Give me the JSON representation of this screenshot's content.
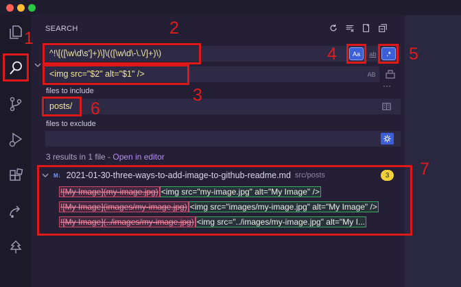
{
  "window": {
    "controls": [
      {
        "name": "close",
        "color": "#fe5f57"
      },
      {
        "name": "minimize",
        "color": "#febc2e"
      },
      {
        "name": "maximize",
        "color": "#28c840"
      }
    ]
  },
  "activity_bar": {
    "items": [
      {
        "id": "explorer",
        "icon": "files-icon"
      },
      {
        "id": "search",
        "icon": "search-icon",
        "active": true
      },
      {
        "id": "source-control",
        "icon": "source-control-icon"
      },
      {
        "id": "run-debug",
        "icon": "run-debug-icon"
      },
      {
        "id": "extensions",
        "icon": "extensions-icon"
      },
      {
        "id": "remote",
        "icon": "remote-icon"
      },
      {
        "id": "tree",
        "icon": "tree-icon"
      }
    ]
  },
  "search": {
    "title": "SEARCH",
    "actions": [
      "refresh-icon",
      "clear-results-icon",
      "new-search-editor-icon",
      "collapse-all-icon"
    ],
    "query": "^!\\[([\\w\\d\\s']+)\\]\\(([\\w\\d\\-\\.\\/]+)\\)",
    "replace": "<img src=\"$2\" alt=\"$1\" />",
    "match_case_label": "Aa",
    "whole_word_label": "ab",
    "regex_label": ".*",
    "preserve_case_label": "AB",
    "files_to_include_label": "files to include",
    "files_to_include": "posts/",
    "files_to_exclude_label": "files to exclude",
    "files_to_exclude": "",
    "more_options": "···"
  },
  "results": {
    "summary": "3 results in 1 file - ",
    "open_in_editor": "Open in editor",
    "file": {
      "badge": "M↓",
      "name": "2021-01-30-three-ways-to-add-image-to-github-readme.md",
      "path": "src/posts",
      "count": "3"
    },
    "matches": [
      {
        "old": "![My Image](my-image.jpg)",
        "new": "<img src=\"my-image.jpg\" alt=\"My Image\" />"
      },
      {
        "old": "![My Image](images/my-image.jpg)",
        "new": "<img src=\"images/my-image.jpg\" alt=\"My Image\" />"
      },
      {
        "old": "![My Image](../images/my-image.jpg)",
        "new": "<img src=\"../images/my-image.jpg\" alt=\"My I..."
      }
    ]
  },
  "annotations": {
    "labels": [
      "1",
      "2",
      "3",
      "4",
      "5",
      "6",
      "7"
    ],
    "color": "#e01818"
  }
}
